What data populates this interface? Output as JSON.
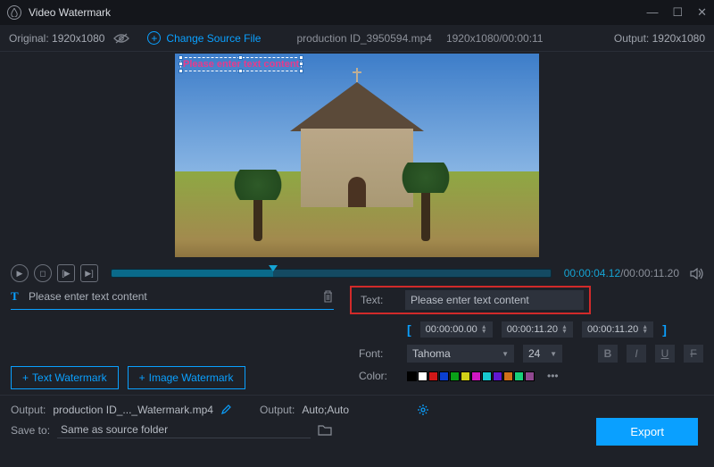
{
  "app": {
    "title": "Video Watermark"
  },
  "topbar": {
    "original_label": "Original:",
    "original_value": "1920x1080",
    "change_source": "Change Source File",
    "file_name": "production ID_3950594.mp4",
    "file_meta": "1920x1080/00:00:11",
    "output_label": "Output:",
    "output_value": "1920x1080"
  },
  "preview": {
    "watermark_text": "Please enter text content"
  },
  "transport": {
    "current": "00:00:04.12",
    "duration": "/00:00:11.20"
  },
  "layer": {
    "name": "Please enter text content"
  },
  "buttons": {
    "text_wm": "Text Watermark",
    "image_wm": "Image Watermark",
    "export": "Export"
  },
  "panel": {
    "text_label": "Text:",
    "text_value": "Please enter text content",
    "range_start": "00:00:00.00",
    "range_mid": "00:00:11.20",
    "range_end": "00:00:11.20",
    "font_label": "Font:",
    "font_family": "Tahoma",
    "font_size": "24",
    "color_label": "Color:"
  },
  "colors": [
    "#000000",
    "#ffffff",
    "#d01818",
    "#0b3fd0",
    "#0aa018",
    "#d0d018",
    "#d018c4",
    "#18c8d0",
    "#6018d0",
    "#d07018",
    "#18d07a",
    "#904890"
  ],
  "bottom": {
    "output_label": "Output:",
    "output_file": "production ID_..._Watermark.mp4",
    "output2_label": "Output:",
    "output2_value": "Auto;Auto",
    "save_label": "Save to:",
    "save_value": "Same as source folder"
  }
}
